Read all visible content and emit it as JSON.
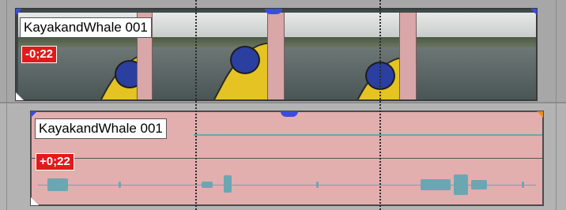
{
  "video_event": {
    "clip_name": "KayakandWhale 001",
    "offset": "-0;22"
  },
  "audio_event": {
    "clip_name": "KayakandWhale 001",
    "offset": "+0;22"
  },
  "colors": {
    "event_audio": "#e3aeae",
    "offset_badge": "#e11b1b",
    "marker_blue": "#3b4ce0",
    "marker_orange": "#e98f1f",
    "waveform": "#6aa7b2"
  }
}
